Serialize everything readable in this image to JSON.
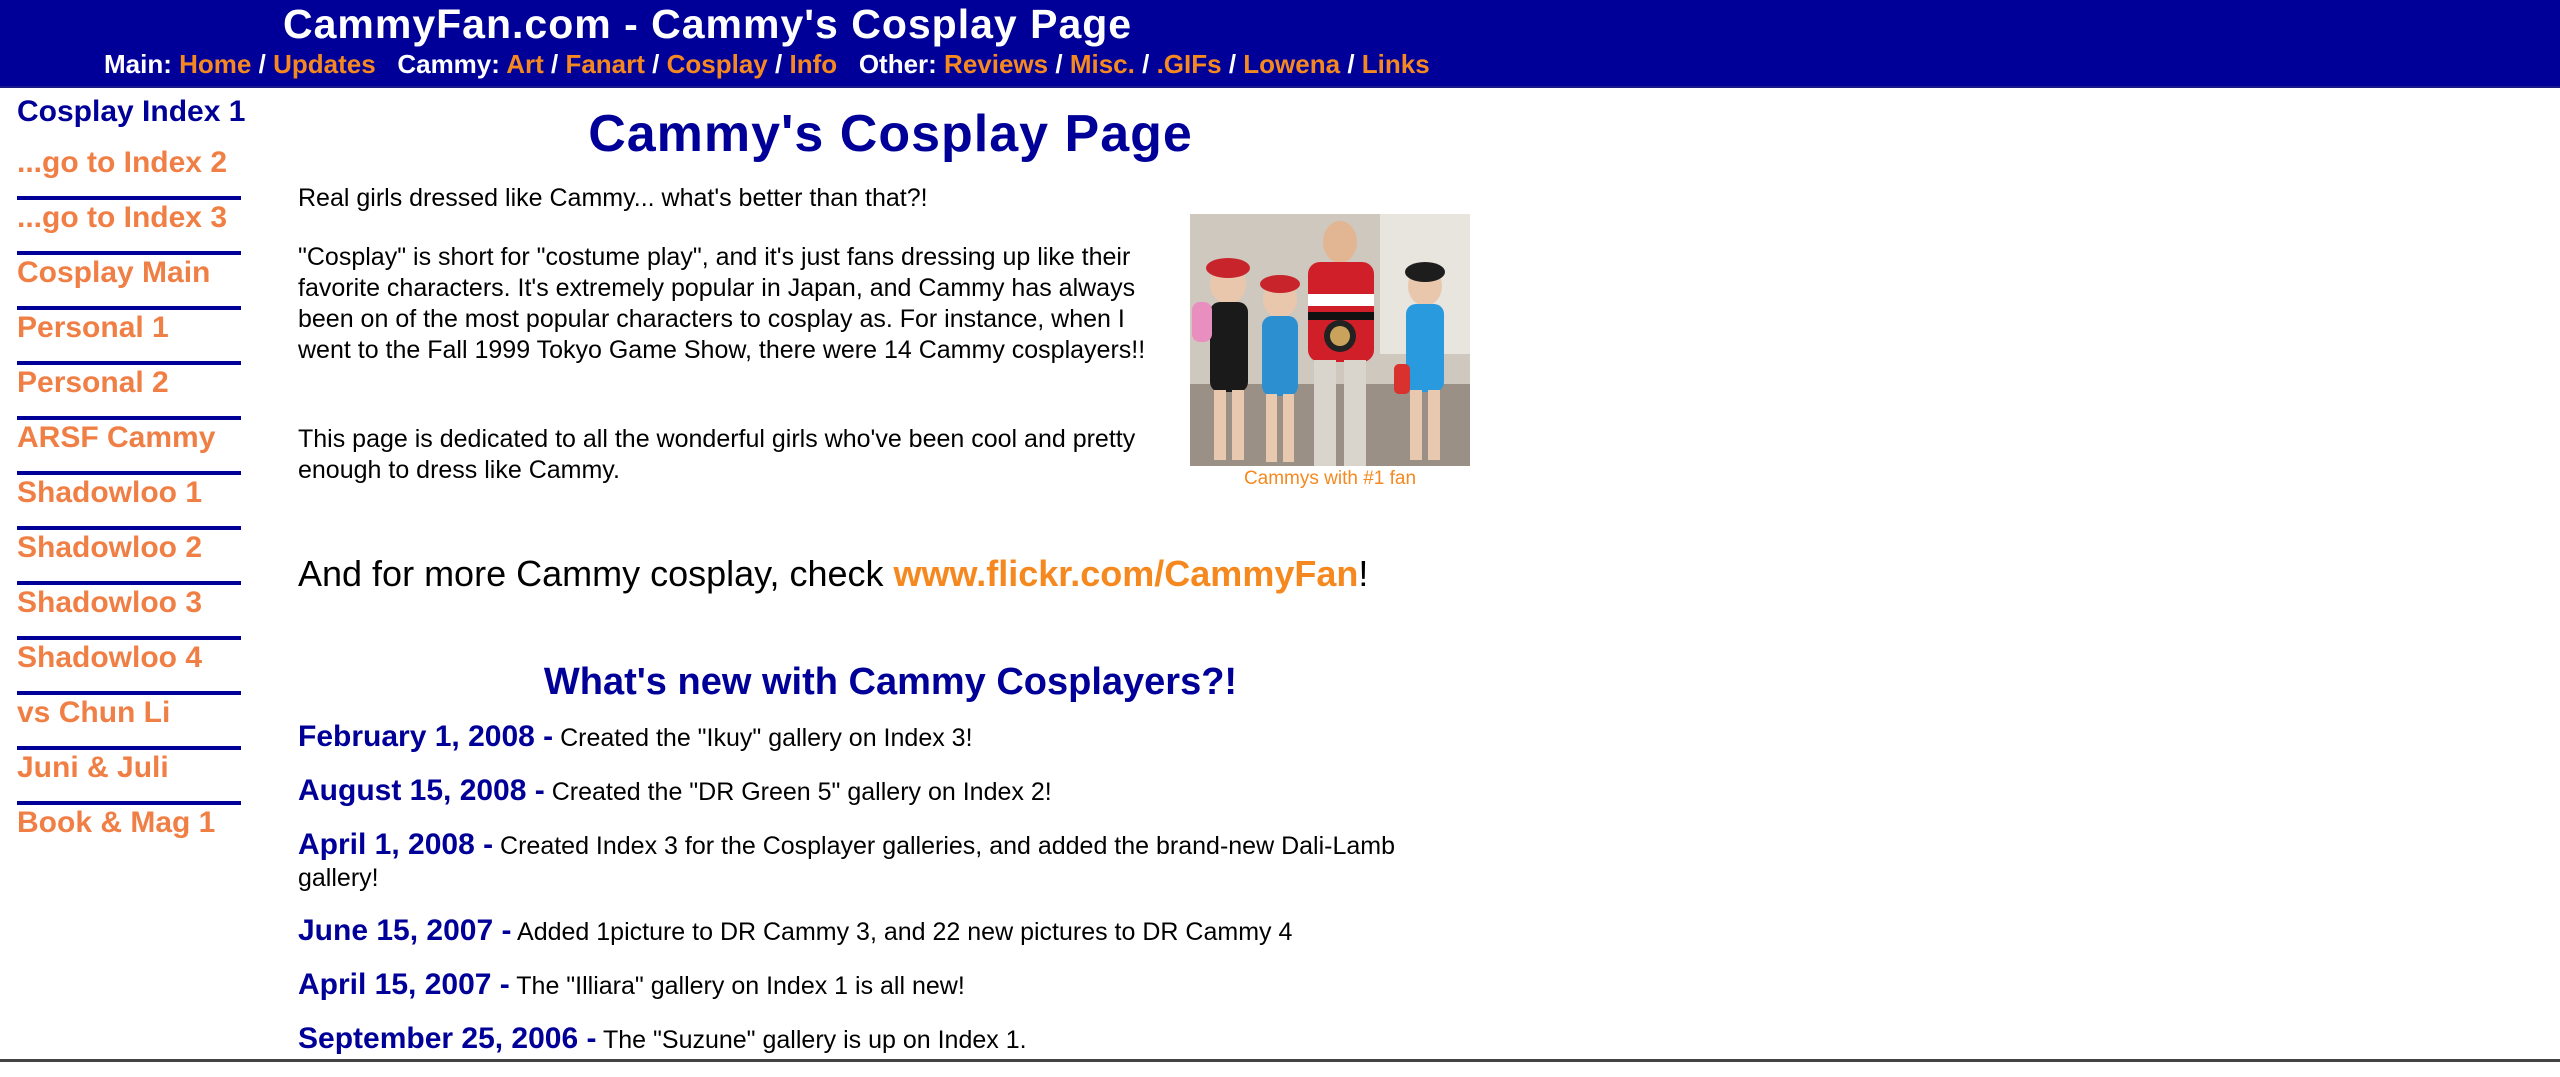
{
  "header": {
    "title": "CammyFan.com - Cammy's Cosplay Page",
    "nav": {
      "main_label": "Main:",
      "main_links": [
        "Home",
        "Updates"
      ],
      "cammy_label": "Cammy:",
      "cammy_links": [
        "Art",
        "Fanart",
        "Cosplay",
        "Info"
      ],
      "other_label": "Other:",
      "other_links": [
        "Reviews",
        "Misc.",
        ".GIFs",
        "Lowena",
        "Links"
      ]
    }
  },
  "sidebar": {
    "current": "Cosplay Index 1",
    "items": [
      "...go to Index 2",
      "...go to Index 3",
      "Cosplay Main",
      "Personal 1",
      "Personal 2",
      "ARSF Cammy",
      "Shadowloo 1",
      "Shadowloo 2",
      "Shadowloo 3",
      "Shadowloo 4",
      "vs Chun Li",
      "Juni & Juli",
      "Book & Mag 1"
    ]
  },
  "main": {
    "title": "Cammy's Cosplay Page",
    "intro": "Real girls dressed like Cammy... what's better than that?!",
    "para2": "\"Cosplay\" is short for \"costume play\", and it's just fans dressing up like their favorite characters.  It's extremely popular in Japan, and Cammy has always been on of the most popular characters to cosplay as.  For instance, when I went to the Fall 1999 Tokyo Game Show, there were 14 Cammy cosplayers!!",
    "para3": "This page is dedicated to all the wonderful girls who've been cool and pretty enough to dress like Cammy.",
    "photo_caption": "Cammys with #1 fan",
    "more_prefix": "And for more Cammy cosplay, check ",
    "more_link": "www.flickr.com/CammyFan",
    "more_suffix": "!",
    "news_title": "What's new with Cammy Cosplayers?!",
    "news": [
      {
        "date": "February 1, 2008 -",
        "text": " Created the \"Ikuy\" gallery on Index 3!"
      },
      {
        "date": "August 15, 2008 -",
        "text": " Created the \"DR Green 5\" gallery on Index 2!"
      },
      {
        "date": "April 1, 2008 -",
        "text": " Created Index 3 for the Cosplayer galleries, and added the brand-new Dali-Lamb gallery!"
      },
      {
        "date": "June 15, 2007 -",
        "text": " Added 1picture to DR Cammy 3, and 22 new pictures to DR Cammy 4"
      },
      {
        "date": "April 15, 2007 -",
        "text": " The \"Illiara\" gallery on Index 1 is all new!"
      },
      {
        "date": "September 25, 2006 -",
        "text": " The \"Suzune\" gallery is up on Index 1."
      }
    ]
  },
  "colors": {
    "header_bg": "#000099",
    "link_orange": "#f5891f",
    "sidebar_link": "#f07f45",
    "heading_blue": "#000099"
  }
}
